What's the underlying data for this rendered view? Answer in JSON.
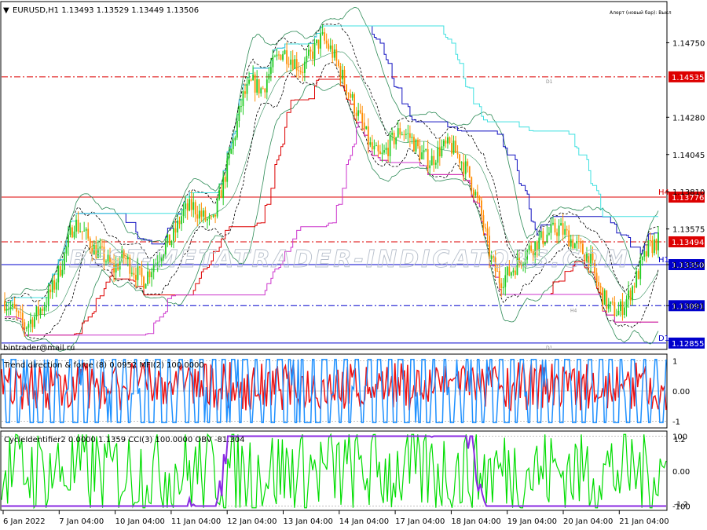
{
  "symbol_header": "EURUSD,H1  1.13493 1.13529 1.13449 1.13506",
  "alert_text": "Алерт (новый бар): Выкл",
  "watermark": "BEST-METATRADER-INDICATORS.COM",
  "email_label": "bintrader@mail.ru",
  "colors": {
    "background": "#ffffff",
    "grid_text": "#000000",
    "bull_candle": "#22cc22",
    "bear_candle": "#ff8c00",
    "bollinger": "#2e8b57",
    "keltner_dash": "#000000",
    "blue_channel": "#1010c0",
    "cyan_channel": "#40e0e0",
    "red_step": "#dd0000",
    "magenta_step": "#cc33cc",
    "level_red": "#dd0000",
    "level_blue": "#0000cc",
    "trend_red": "#ee1111",
    "trend_blue": "#1e90ff",
    "cycle_green": "#00dd00",
    "cycle_purple": "#8a2be2"
  },
  "chart_data": [
    {
      "type": "candlestick",
      "title": "EURUSD,H1",
      "ohlc_last": {
        "open": 1.13493,
        "high": 1.13529,
        "low": 1.13449,
        "close": 1.13506
      },
      "ylim": [
        1.1282,
        1.15
      ],
      "y_ticks": [
        "1.14750",
        "1.14280",
        "1.14045",
        "1.13810",
        "1.13575",
        "1.13350",
        "1.13091"
      ],
      "x_labels": [
        "6 Jan 2022",
        "7 Jan 04:00",
        "10 Jan 04:00",
        "11 Jan 04:00",
        "12 Jan 04:00",
        "13 Jan 04:00",
        "14 Jan 04:00",
        "17 Jan 04:00",
        "18 Jan 04:00",
        "19 Jan 04:00",
        "20 Jan 04:00",
        "21 Jan 04:00"
      ],
      "close_path": [
        1.1312,
        1.1305,
        1.1296,
        1.1302,
        1.131,
        1.1322,
        1.134,
        1.1362,
        1.1355,
        1.1345,
        1.134,
        1.1332,
        1.134,
        1.1332,
        1.1325,
        1.1335,
        1.1345,
        1.1352,
        1.1368,
        1.1372,
        1.1365,
        1.136,
        1.1385,
        1.141,
        1.144,
        1.145,
        1.1445,
        1.146,
        1.147,
        1.1465,
        1.1458,
        1.1468,
        1.1478,
        1.147,
        1.1455,
        1.144,
        1.1425,
        1.1408,
        1.1402,
        1.1412,
        1.142,
        1.1415,
        1.1405,
        1.14,
        1.1408,
        1.141,
        1.1402,
        1.139,
        1.137,
        1.134,
        1.1325,
        1.133,
        1.1338,
        1.1345,
        1.135,
        1.1355,
        1.1358,
        1.1352,
        1.1345,
        1.134,
        1.132,
        1.1308,
        1.1305,
        1.1315,
        1.133,
        1.1345,
        1.135
      ],
      "levels": [
        {
          "label": "1.14535",
          "value": 1.14535,
          "color": "#dd0000",
          "style": "dashdot"
        },
        {
          "label": "1.13776",
          "value": 1.13776,
          "color": "#dd0000",
          "style": "solid",
          "tag": "H4"
        },
        {
          "label": "1.13494",
          "value": 1.13494,
          "color": "#dd0000",
          "style": "dashdot"
        },
        {
          "label": "1.13350",
          "value": 1.1335,
          "color": "#0000cc",
          "style": "solid",
          "tag": "H1"
        },
        {
          "label": "1.13091",
          "value": 1.13091,
          "color": "#0000cc",
          "style": "dashdot"
        },
        {
          "label": "1.12855",
          "value": 1.12855,
          "color": "#0000cc",
          "style": "solid",
          "tag": "D1"
        }
      ],
      "marker_labels": [
        "D1",
        "H4",
        "D1"
      ]
    },
    {
      "type": "line",
      "title": "Trend direction & force (8) 0.0952  MFI(2) 100.0000",
      "ylim": [
        -1.2,
        1.2
      ],
      "y_ticks": [
        "1",
        "0.00",
        "-1"
      ],
      "series": [
        {
          "name": "Trend direction & force (8)"
        },
        {
          "name": "MFI(2)"
        }
      ]
    },
    {
      "type": "line",
      "title": "CycleIdentifier2 0.0000 1.1359  CCI(3) 100.0000  OBV -81.304",
      "ylim": [
        -110,
        110
      ],
      "y_ticks": [
        "100",
        "1.2",
        "0.00",
        "-1.2",
        "-100"
      ],
      "series": [
        {
          "name": "CCI(3)"
        },
        {
          "name": "OBV"
        }
      ]
    }
  ]
}
